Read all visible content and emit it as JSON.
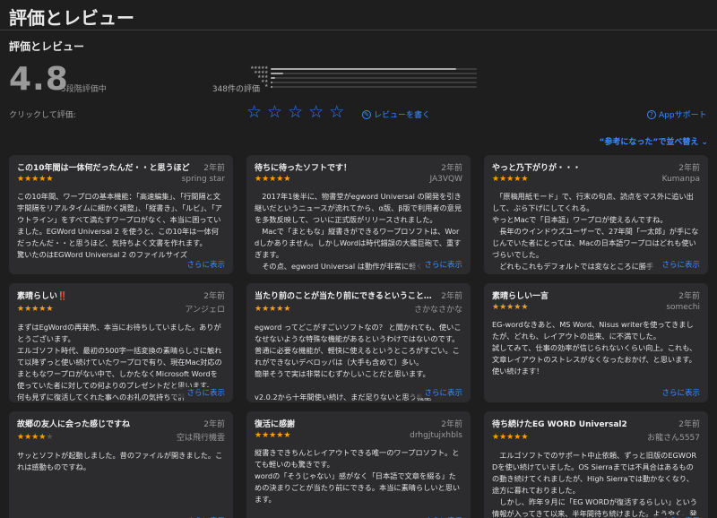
{
  "page": {
    "title": "評価とレビュー"
  },
  "ratings": {
    "section_title": "評価とレビュー",
    "average": "4.8",
    "out_of": "5段階評価中",
    "count": "348件の評価",
    "histogram": [
      {
        "stars": 5,
        "fraction": 0.9
      },
      {
        "stars": 4,
        "fraction": 0.06
      },
      {
        "stars": 3,
        "fraction": 0.02
      },
      {
        "stars": 2,
        "fraction": 0.01
      },
      {
        "stars": 1,
        "fraction": 0.01
      }
    ]
  },
  "tap_to_rate": {
    "label": "クリックして評価:",
    "star_glyph": "☆"
  },
  "write_review": "レビューを書く",
  "app_support": "Appサポート",
  "sort": "“参考になった”で並べ替え ⌄",
  "more_label": "さらに表示",
  "colors": {
    "accent": "#3b8bff",
    "star": "#ff9f0a",
    "card": "#2c2c2e",
    "background": "#1e1e1e"
  },
  "reviews": [
    {
      "title": "この10年間は一体何だったんだ・・と思うほど",
      "date": "2年前",
      "author": "spring star",
      "rating": 5,
      "body": "この10年間、ワープロの基本機能：「高速編集」、「行間隔と文字間隔をリアルタイムに細かく調整」、「縦書き」、「ルビ」、「アウトライン」をすべて満たすワープロがなく、本当に困っていました。EGWord Universal 2 を使うと、この10年は一体何だったんだ・・と思うほど、気持ちよく文書を作れます。\n驚いたのはEGWord Universal 2 のファイルサイズ"
    },
    {
      "title": "待ちに待ったソフトです！",
      "date": "2年前",
      "author": "JA3VQW",
      "rating": 5,
      "body": "　2017年1後半に、物書堂がegword Universal の開発を引き継いだというニュースが流れてから、α版、β版で利用者の意見を多数反映して、ついに正式版がリリースされました。\n　Macで「まともな」縦書きができるワープロソフトは、Wordしかありません。しかしWordは時代錯誤の大艦巨砲で、重すぎます。\n　その点、egword Universal は動作が非常に軽く"
    },
    {
      "title": "やっと乃下がりが・・・",
      "date": "2年前",
      "author": "Kumanpa",
      "rating": 5,
      "body": "　「原稿用紙モード」で、行末の句点、読点をマス外に追い出して、ぶら下げにしてくれる。\nやっとMacで「日本語」ワープロが使えるんですね。\n　長年のウインドウズユーザーで、27年間「一太郎」が手になじんでいた者にとっては、Macの日本語ワープロはどれも使いづらいでした。\n　どれもこれもデフォルトでは変なところに勝手"
    },
    {
      "title": "素晴らしい‼️",
      "date": "2年前",
      "author": "アンジェロ",
      "rating": 5,
      "body": "まずはEgWordの再発売、本当にお待ちしていました。ありがとうございます。\nエルゴソフト時代、最初の500字一括変換の素晴らしさに触れて以降ずっと使い続けていたワープロで有り、現在Mac対応のまともなワープロがない中で、しかたなくMicrosoft Wordを使っていた者に対しての何よりのプレゼントだと思います。\n何も見ずに復活してくれた事へのお礼の気持ちで評"
    },
    {
      "title": "当たり前のことが当たり前にできるということのすごさ",
      "date": "2年前",
      "author": "さかなさかな",
      "rating": 5,
      "body": "egword ってどこがすごいソフトなの？ と聞かれても、使いこなせないような特殊な機能があるというわけではないのです。普通に必要な機能が、軽快に使えるというところがすごい。これができないデベロッパは（大手も含めて）多い。\n簡単そうで実は非常にむずかしいことだと思います。\n\nv2.0.2から十年間使い続け、まだ足りないと思う機能"
    },
    {
      "title": "素晴らしい一言",
      "date": "2年前",
      "author": "somechi",
      "rating": 5,
      "body": "EG-wordなきあと、MS Word、Nisus writerを使ってきましたが、どれも、レイアウトの出来、に不満でした。\n試してみて、仕事の効率が信じられないくらい向上。これも、文章レイアウトのストレスがなくなったおかげ、と思います。\n使い続けます！"
    },
    {
      "title": "故郷の友人に会った感じですね",
      "date": "2年前",
      "author": "空は飛行機雲",
      "rating": 4,
      "body": "サッとソフトが起動しました。昔のファイルが開きました。これは感動ものですね。"
    },
    {
      "title": "復活に感謝",
      "date": "2年前",
      "author": "drhgjtujxhbls",
      "rating": 5,
      "body": "縦書きできちんとレイアウトできる唯一のワープロソフト。とても軽いのも驚きです。\nwordの「そうじゃない」感がなく「日本語で文章を綴る」ための決まりごとが当たり前にできる。本当に素晴らしいと思います。\n\n最初から日本語を扱うことを念頭に作成されていること、考えて見れば当たり前のことですが、今までのストレス"
    },
    {
      "title": "待ち続けたEG WORD Universal2",
      "date": "2年前",
      "author": "お龍さん5557",
      "rating": 5,
      "body": "　エルゴソフトでのサポート中止依頼、ずっと旧版のEGWORDを使い続けていました。OS Sierraまでは不具合はあるものの動き続けてくれましたが、High Sierraでは動かなくなり、途方に暮れておりました。\n　しかし、昨年９月に「EG WORDが復活するらしい」という情報が入ってきて以来、半年間待ち続けました。ようやく、発売の日を迎え、感激です。"
    }
  ]
}
